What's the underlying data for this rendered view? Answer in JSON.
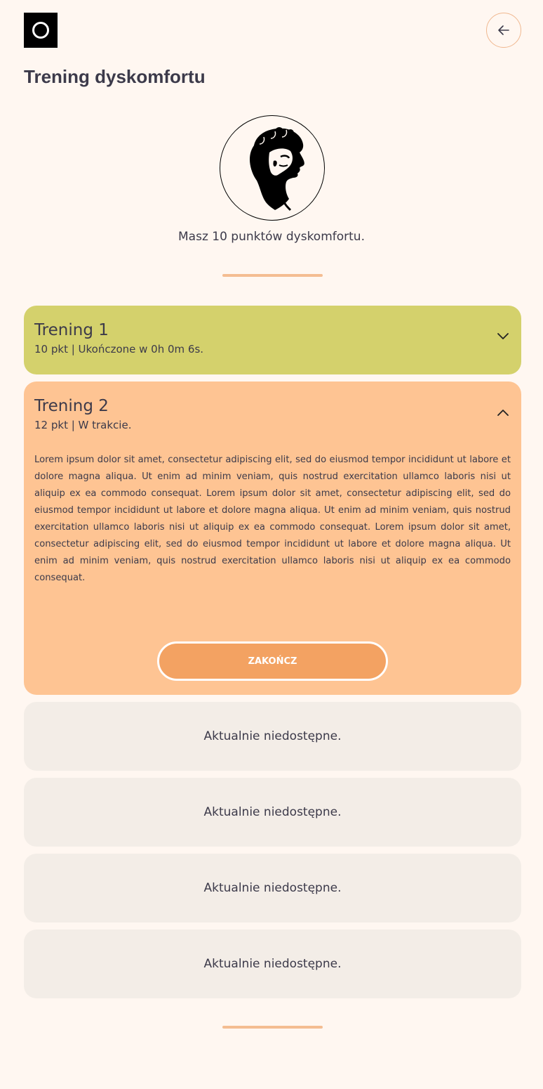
{
  "header": {
    "title": "Trening dyskomfortu",
    "back_icon": "arrow-left-icon",
    "logo_icon": "ring-logo-icon"
  },
  "profile": {
    "avatar": "statue-head-portrait",
    "points_text": "Masz 10 punktów dyskomfortu."
  },
  "trainings": [
    {
      "title": "Trening 1",
      "subtitle": "10 pkt | Ukończone w 0h 0m 6s.",
      "state": "collapsed",
      "icon": "chevron-down-icon",
      "color": "#d4d16c"
    },
    {
      "title": "Trening 2",
      "subtitle": "12 pkt | W trakcie.",
      "state": "expanded",
      "icon": "chevron-up-icon",
      "color": "#fec493",
      "body": "Lorem ipsum dolor sit amet, consectetur adipiscing elit, sed do eiusmod tempor incididunt ut labore et dolore magna aliqua. Ut enim ad minim veniam, quis nostrud exercitation ullamco laboris nisi ut aliquip ex ea commodo consequat. Lorem ipsum dolor sit amet, consectetur adipiscing elit, sed do eiusmod tempor incididunt ut labore et dolore magna aliqua. Ut enim ad minim veniam, quis nostrud exercitation ullamco laboris nisi ut aliquip ex ea commodo consequat. Lorem ipsum dolor sit amet, consectetur adipiscing elit, sed do eiusmod tempor incididunt ut labore et dolore magna aliqua. Ut enim ad minim veniam, quis nostrud exercitation ullamco laboris nisi ut aliquip ex ea commodo consequat.",
      "button_label": "ZAKOŃCZ"
    }
  ],
  "locked": [
    "Aktualnie niedostępne.",
    "Aktualnie niedostępne.",
    "Aktualnie niedostępne.",
    "Aktualnie niedostępne."
  ],
  "colors": {
    "background": "#fff7f1",
    "accent": "#f3a262",
    "divider": "#f4bd92",
    "locked": "#f3ede7"
  }
}
